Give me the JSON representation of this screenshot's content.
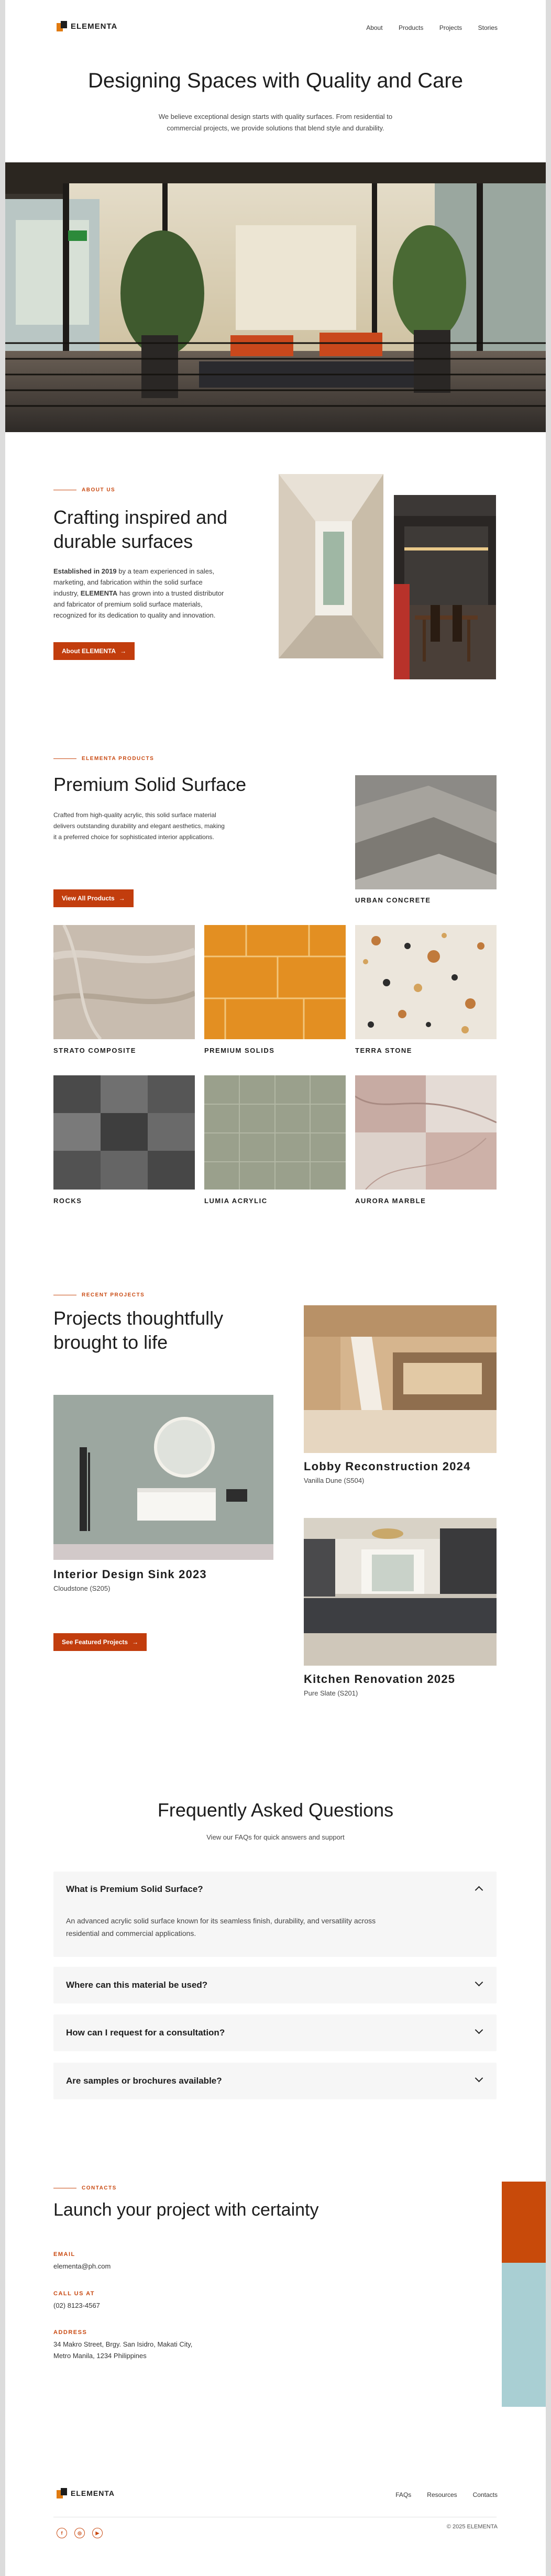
{
  "header": {
    "brand": "ELEMENTA",
    "nav": [
      "About",
      "Products",
      "Projects",
      "Stories"
    ]
  },
  "hero": {
    "title": "Designing Spaces with Quality and Care",
    "subtitle_line1": "We believe exceptional design starts with quality surfaces. From residential to",
    "subtitle_line2": "commercial projects, we provide solutions that blend style and durability."
  },
  "about": {
    "kicker": "ABOUT US",
    "title_line1": "Crafting inspired and",
    "title_line2": "durable surfaces",
    "p_established": "Established in 2019",
    "p_rest1": " by a team experienced in sales,",
    "p_line2": "marketing, and fabrication within the solid surface",
    "p_line3a": "industry, ",
    "p_brand": "ELEMENTA",
    "p_line3b": " has grown into a trusted distributor",
    "p_line4": "and fabricator of premium solid surface materials,",
    "p_line5": "recognized for its dedication to quality and innovation.",
    "button": "About ELEMENTA"
  },
  "products": {
    "kicker": "ELEMENTA PRODUCTS",
    "title": "Premium Solid Surface",
    "desc_line1": "Crafted from high-quality acrylic, this solid surface material",
    "desc_line2": "delivers outstanding durability and elegant aesthetics, making",
    "desc_line3": "it a preferred choice for sophisticated interior applications.",
    "button": "View All Products",
    "tiles": [
      "URBAN CONCRETE",
      "STRATO COMPOSITE",
      "PREMIUM SOLIDS",
      "TERRA STONE",
      "ROCKS",
      "LUMIA ACRYLIC",
      "AURORA MARBLE"
    ]
  },
  "projects": {
    "kicker": "RECENT PROJECTS",
    "title_line1": "Projects thoughtfully",
    "title_line2": "brought to life",
    "items": [
      {
        "title": "Lobby Reconstruction 2024",
        "sub": "Vanilla Dune (S504)"
      },
      {
        "title": "Interior Design Sink 2023",
        "sub": "Cloudstone (S205)"
      },
      {
        "title": "Kitchen Renovation 2025",
        "sub": "Pure Slate (S201)"
      }
    ],
    "button": "See Featured Projects"
  },
  "faq": {
    "title": "Frequently Asked Questions",
    "subtitle": "View our FAQs for quick answers and support",
    "items": [
      {
        "q": "What is Premium Solid Surface?",
        "a_line1": "An advanced acrylic solid surface known for its seamless finish, durability, and versatility across",
        "a_line2": "residential and commercial applications."
      },
      {
        "q": "Where can this material be used?"
      },
      {
        "q": "How can I request  for a consultation?"
      },
      {
        "q": "Are samples or brochures available?"
      }
    ]
  },
  "contact": {
    "kicker": "CONTACTS",
    "title": "Launch your project with certainty",
    "email_label": "EMAIL",
    "email": "elementa@ph.com",
    "call_label": "CALL US AT",
    "phone": "(02) 8123-4567",
    "address_label": "ADDRESS",
    "address_line1": "34 Makro Street, Brgy. San Isidro, Makati City,",
    "address_line2": "Metro Manila, 1234 Philippines"
  },
  "footer": {
    "brand": "ELEMENTA",
    "links": [
      "FAQs",
      "Resources",
      "Contacts"
    ],
    "copyright": "© 2025 ELEMENTA",
    "social": [
      "facebook-icon",
      "instagram-icon",
      "youtube-icon"
    ]
  },
  "colors": {
    "accent": "#c23d0d",
    "accent_block": "#c84a0a",
    "teal_block": "#a9cfd3"
  }
}
